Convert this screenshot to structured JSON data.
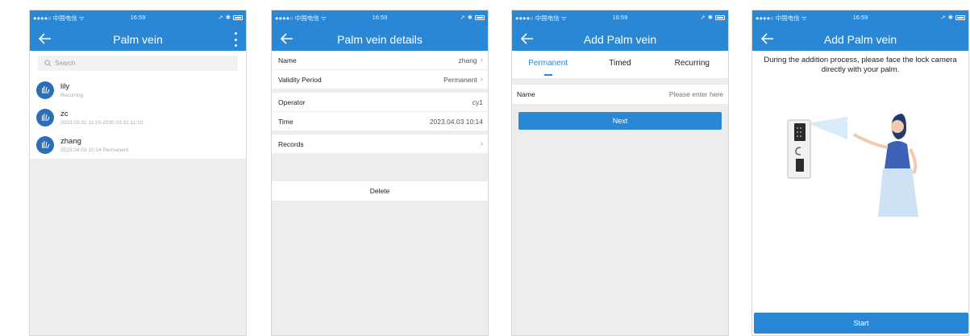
{
  "status_bar": {
    "carrier": "●●●●○ 中国电信 ᯤ",
    "time": "16:59"
  },
  "screen1": {
    "title": "Palm vein",
    "search_placeholder": "Search",
    "users": [
      {
        "name": "lily",
        "detail": "Recurring"
      },
      {
        "name": "zc",
        "detail": "2023.03.31 11:10-2030.03.31 11:10"
      },
      {
        "name": "zhang",
        "detail": "2023.04.03 10:14   Permanent"
      }
    ]
  },
  "screen2": {
    "title": "Palm vein details",
    "rows": [
      {
        "label": "Name",
        "value": "zhang",
        "chevron": true
      },
      {
        "label": "Validity Period",
        "value": "Permanent",
        "chevron": true
      },
      {
        "label": "Operator",
        "value": "cy1",
        "chevron": false
      },
      {
        "label": "Time",
        "value": "2023.04.03 10:14",
        "chevron": false
      },
      {
        "label": "Records",
        "value": "",
        "chevron": true
      }
    ],
    "delete_label": "Delete"
  },
  "screen3": {
    "title": "Add Palm vein",
    "tabs": [
      "Permanent",
      "Timed",
      "Recurring"
    ],
    "active_tab": "Permanent",
    "name_label": "Name",
    "name_placeholder": "Please enter here",
    "next_label": "Next"
  },
  "screen4": {
    "title": "Add Palm vein",
    "instruction": "During the addition process, please face the lock camera directly with your palm.",
    "start_label": "Start"
  },
  "colors": {
    "accent": "#2a87d6",
    "background": "#ededed"
  },
  "icons": [
    "back-arrow-icon",
    "more-vertical-icon",
    "search-icon",
    "palm-avatar-icon",
    "chevron-right-icon"
  ]
}
